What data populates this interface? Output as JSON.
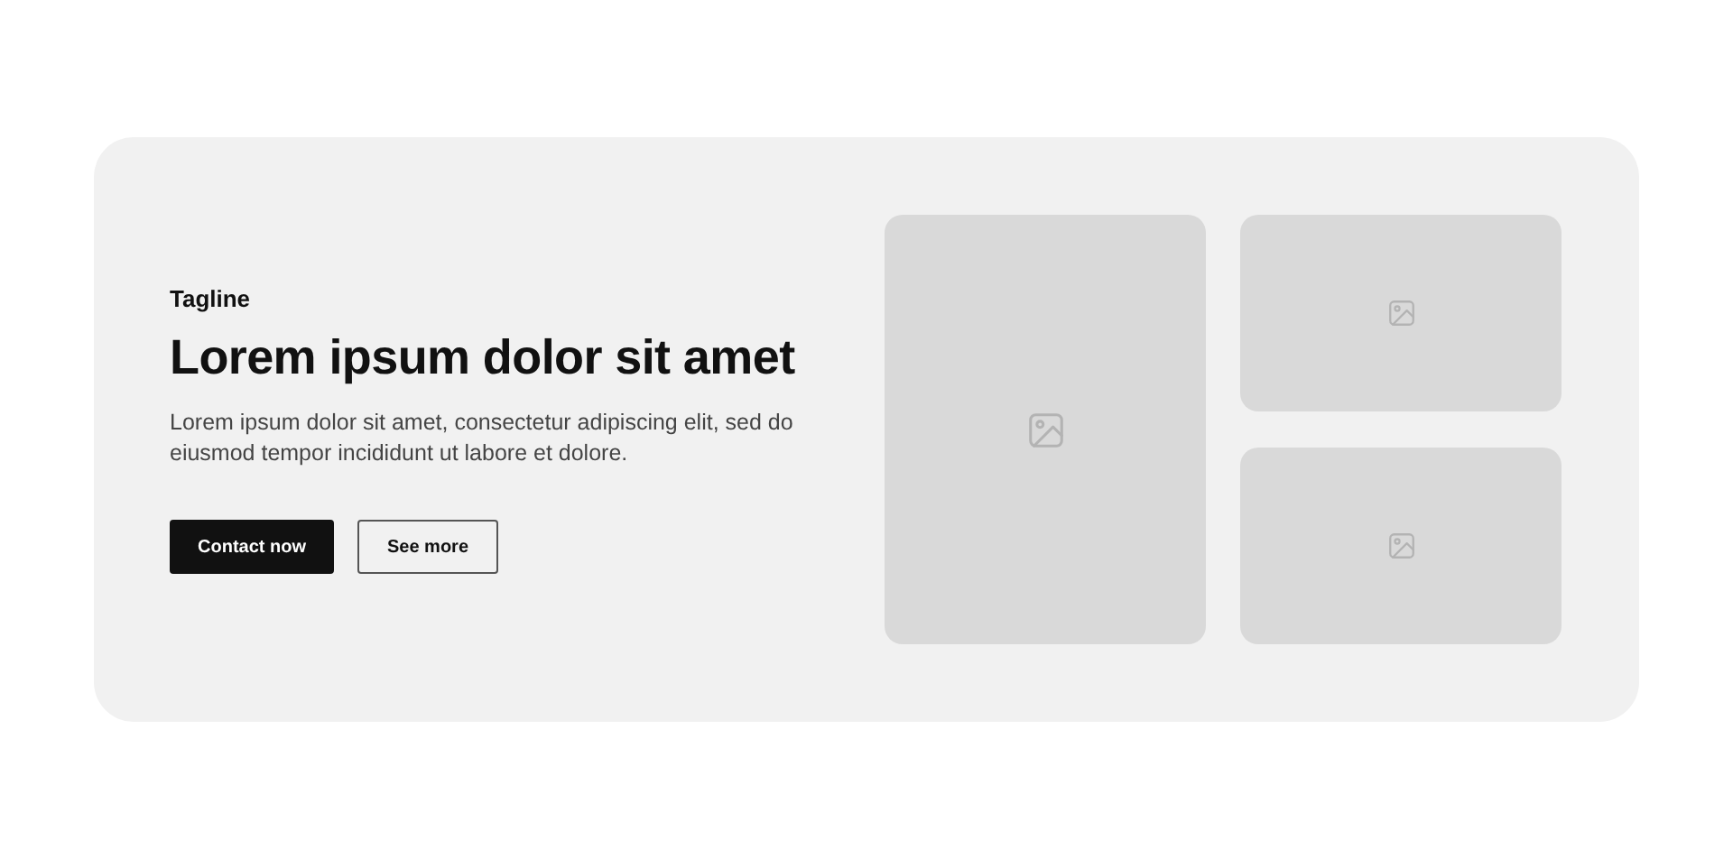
{
  "tagline": "Tagline",
  "heading": "Lorem ipsum dolor sit amet",
  "body": "Lorem ipsum dolor sit amet, consectetur adipiscing elit, sed do eiusmod tempor incididunt ut labore et dolore.",
  "buttons": [
    {
      "label": "Contact now",
      "kind": "primary"
    },
    {
      "label": "See more",
      "kind": "secondary"
    }
  ]
}
